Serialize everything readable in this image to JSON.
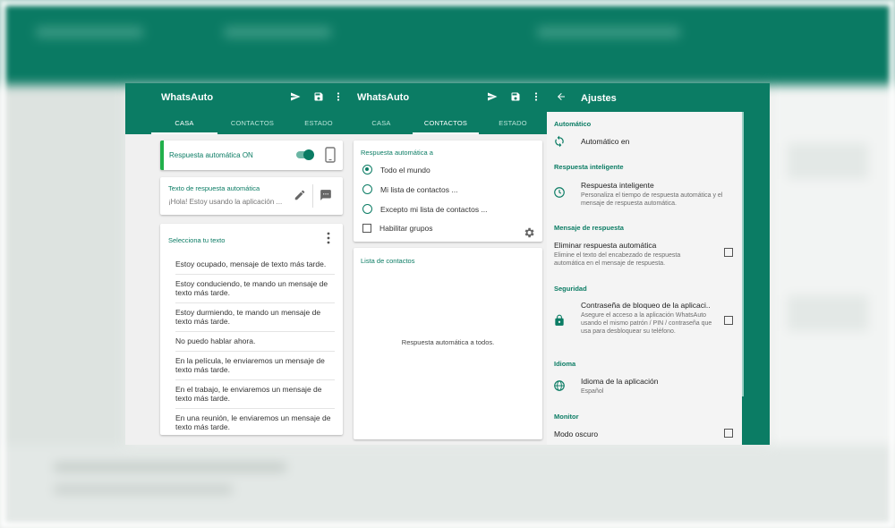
{
  "panel1": {
    "title": "WhatsAuto",
    "tabs": [
      "CASA",
      "CONTACTOS",
      "ESTADO"
    ],
    "active_tab": 0,
    "auto_reply_label": "Respuesta automática ON",
    "auto_reply_on": true,
    "reply_text_label": "Texto de respuesta automática",
    "reply_text_value": "¡Hola! Estoy usando la aplicación ...",
    "select_text_label": "Selecciona tu texto",
    "messages": [
      "Estoy ocupado, mensaje de texto más tarde.",
      "Estoy conduciendo, te mando un mensaje de texto más tarde.",
      "Estoy durmiendo, te mando un mensaje de texto más tarde.",
      "No puedo hablar ahora.",
      "En la película, le enviaremos un mensaje de texto más tarde.",
      "En el trabajo, le enviaremos un mensaje de texto más tarde.",
      "En una reunión, le enviaremos un mensaje de texto más tarde."
    ]
  },
  "panel2": {
    "title": "WhatsAuto",
    "tabs": [
      "CASA",
      "CONTACTOS",
      "ESTADO"
    ],
    "active_tab": 1,
    "reply_to_label": "Respuesta automática a",
    "options": [
      "Todo el mundo",
      "Mi lista de contactos ...",
      "Excepto mi lista de contactos ..."
    ],
    "selected_option": 0,
    "groups_label": "Habilitar grupos",
    "contacts_label": "Lista de contactos",
    "contacts_empty": "Respuesta automática a todos."
  },
  "panel3": {
    "title": "Ajustes",
    "sections": {
      "automatico": "Automático",
      "automatico_item": "Automático en",
      "inteligente": "Respuesta inteligente",
      "inteligente_title": "Respuesta inteligente",
      "inteligente_desc": "Personaliza el tiempo de respuesta automática y el mensaje de respuesta automática.",
      "mensaje": "Mensaje de respuesta",
      "mensaje_title": "Eliminar respuesta automática",
      "mensaje_desc": "Elimine el texto del encabezado de respuesta automática en el mensaje de respuesta.",
      "seguridad": "Seguridad",
      "seguridad_title": "Contraseña de bloqueo de la aplicaci..",
      "seguridad_desc": "Asegure el acceso a la aplicación WhatsAuto usando el mismo patrón / PIN / contraseña que usa para desbloquear su teléfono.",
      "idioma": "Idioma",
      "idioma_title": "Idioma de la aplicación",
      "idioma_value": "Español",
      "monitor": "Monitor",
      "monitor_title": "Modo oscuro"
    }
  },
  "colors": {
    "primary": "#0b7c64",
    "accent_on": "#21b04b"
  }
}
